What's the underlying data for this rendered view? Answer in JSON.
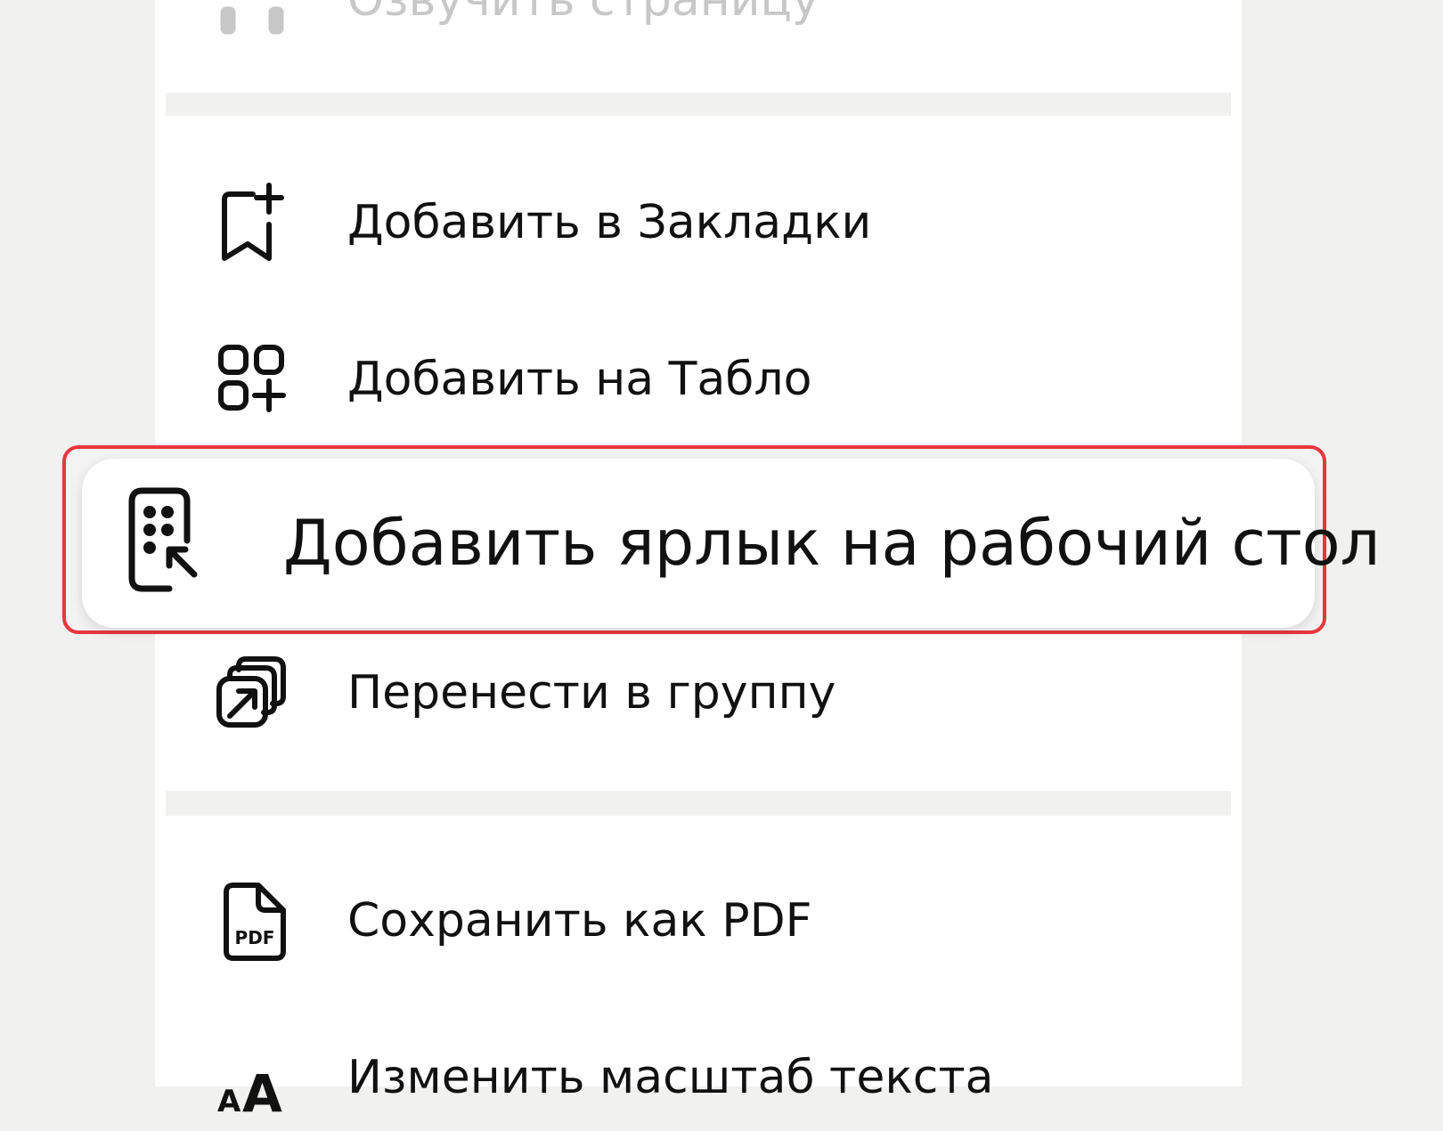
{
  "menu": {
    "items": [
      {
        "id": "read-aloud",
        "label": "Озвучить страницу",
        "icon": "headphones-icon",
        "state": "partially-visible"
      },
      {
        "id": "add-bookmark",
        "label": "Добавить в Закладки",
        "icon": "bookmark-plus-icon"
      },
      {
        "id": "add-to-tablo",
        "label": "Добавить на Табло",
        "icon": "grid-plus-icon"
      },
      {
        "id": "add-shortcut",
        "label": "Добавить ярлык на рабочий стол",
        "icon": "phone-shortcut-icon",
        "highlighted": true
      },
      {
        "id": "move-to-group",
        "label": "Перенести в группу",
        "icon": "move-to-group-icon"
      },
      {
        "id": "save-pdf",
        "label": "Сохранить как PDF",
        "icon": "pdf-file-icon",
        "icon_text": "PDF"
      },
      {
        "id": "text-scale",
        "label": "Изменить масштаб текста",
        "icon": "text-size-icon",
        "icon_text": "AA",
        "state": "partially-visible"
      }
    ]
  },
  "colors": {
    "background": "#f1f1f0",
    "card": "#ffffff",
    "text": "#111111",
    "faded_text": "#c7c7c7",
    "highlight_border": "#e8363e"
  }
}
